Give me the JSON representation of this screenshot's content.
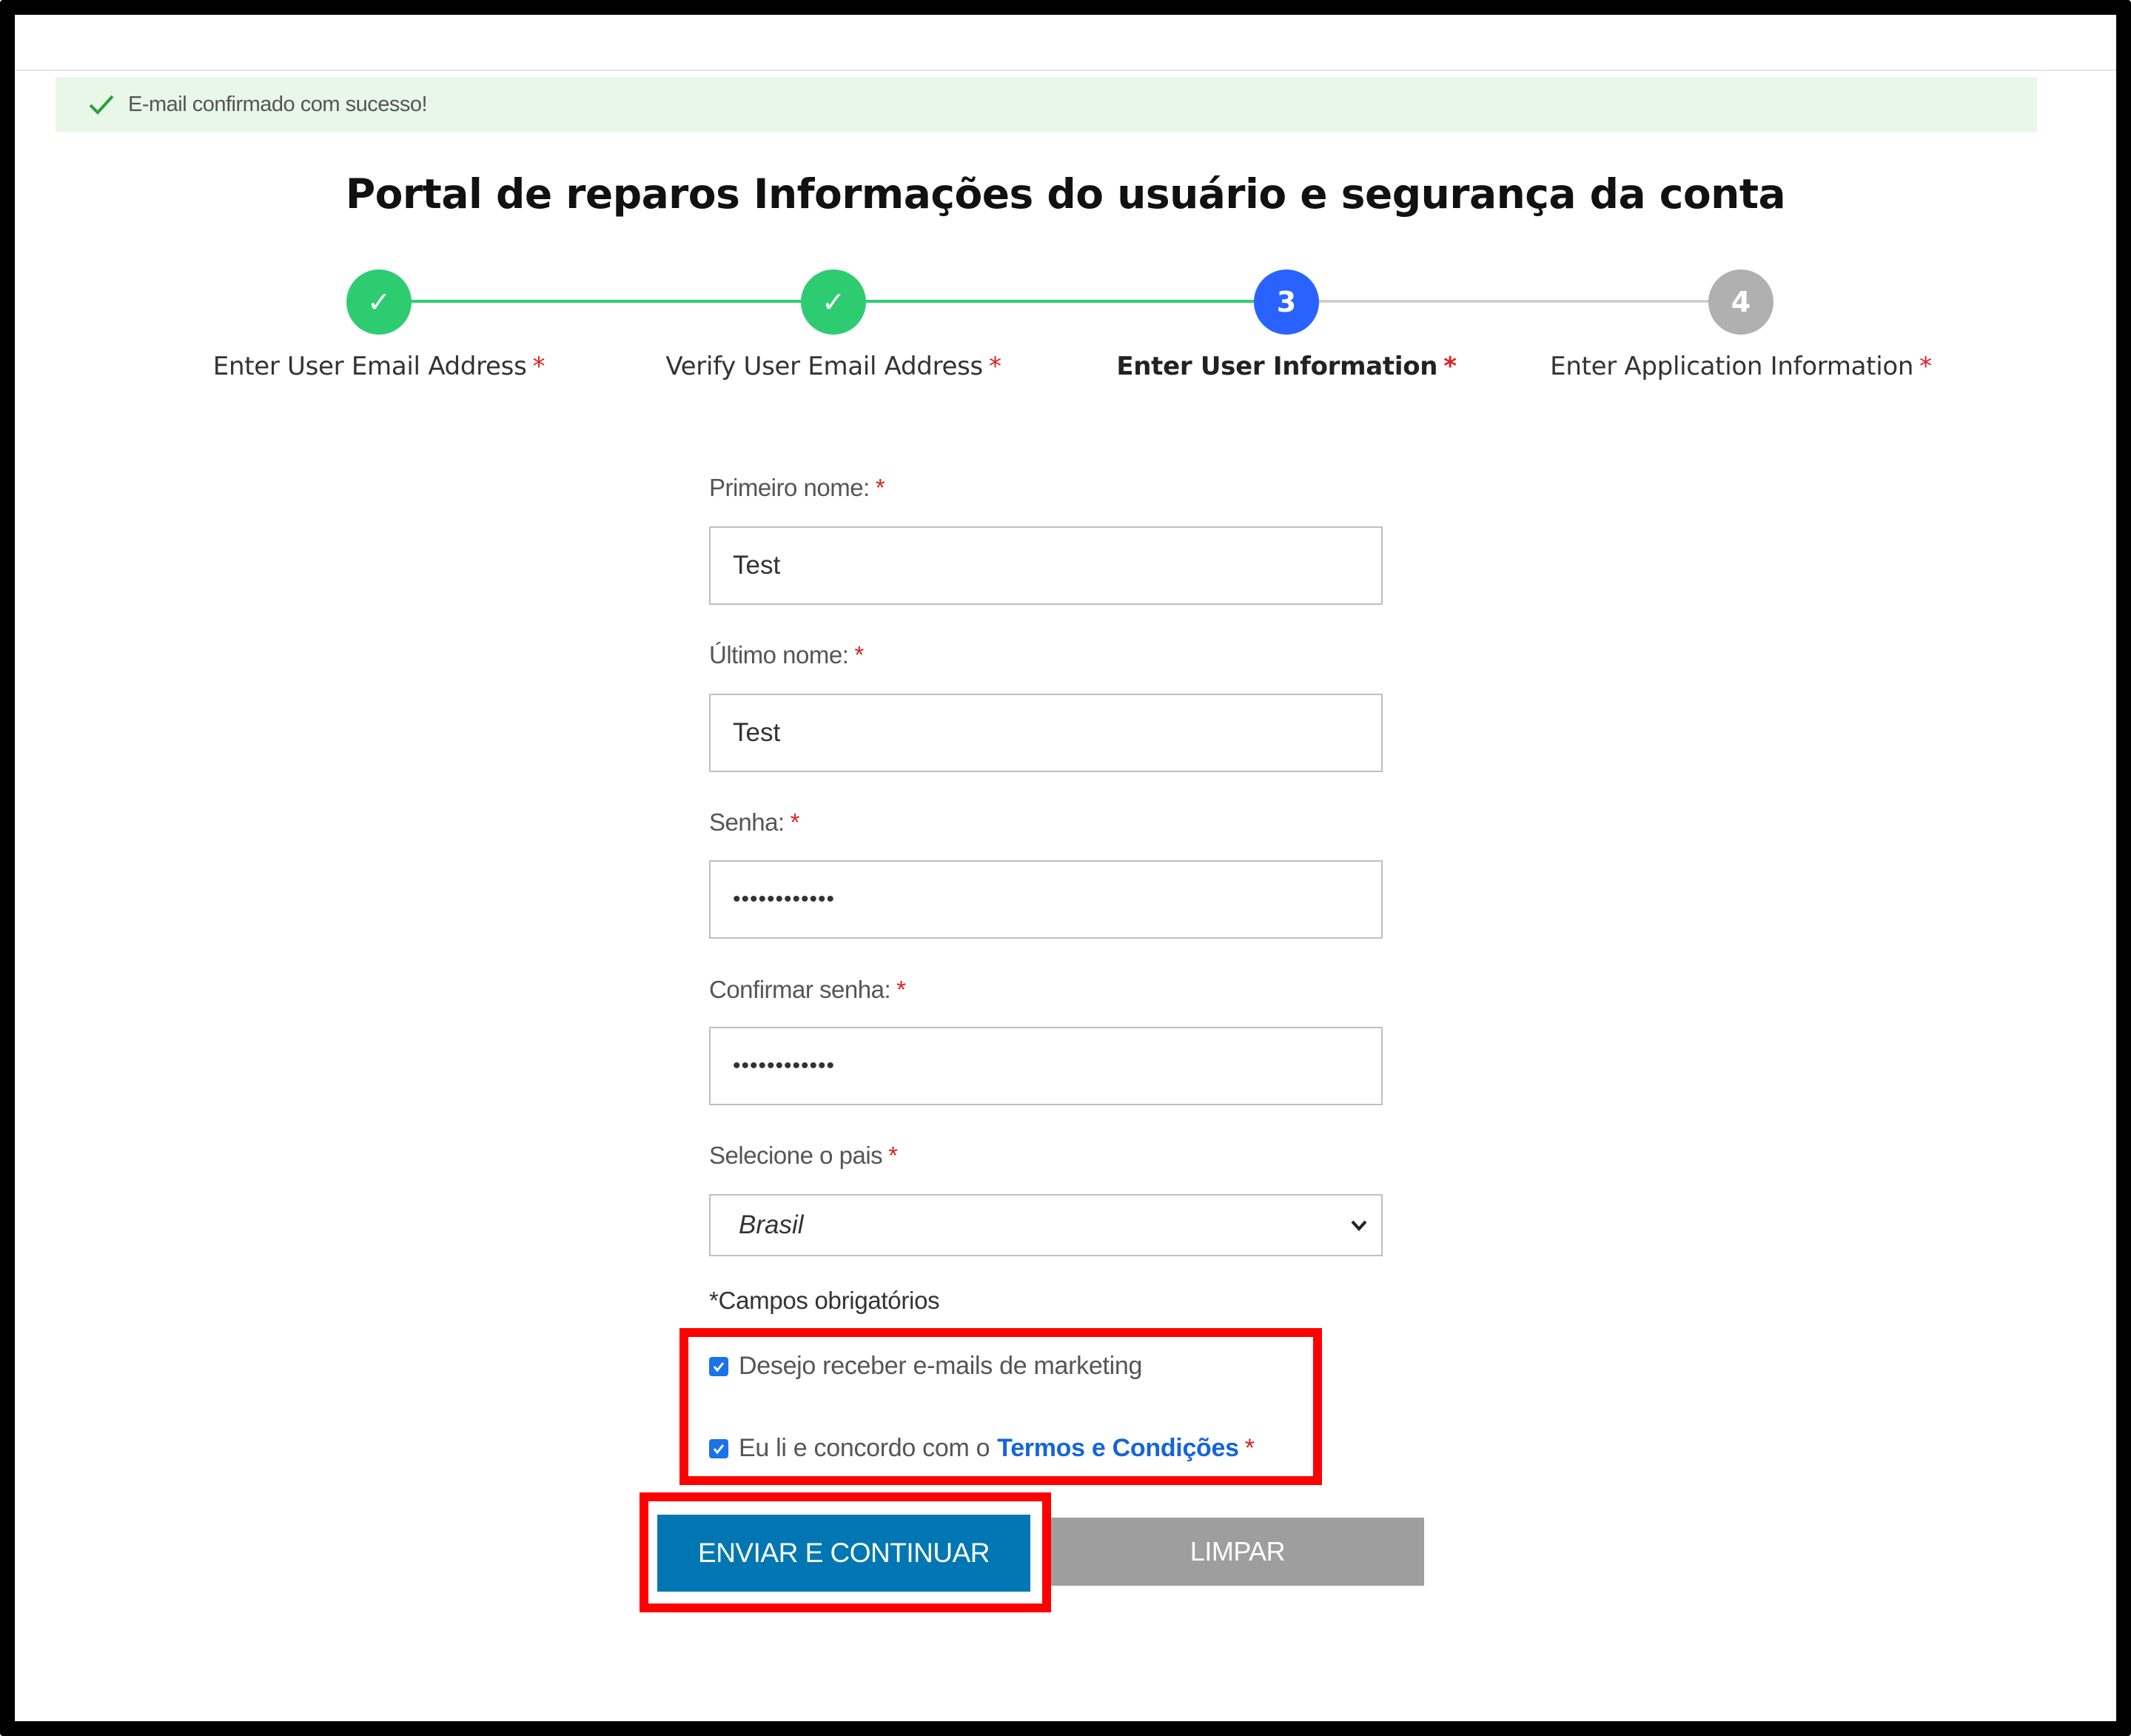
{
  "alert": {
    "icon": "check-icon",
    "message": "E-mail confirmado com sucesso!",
    "color": "#e8f7e8"
  },
  "page": {
    "title": "Portal de reparos Informações do usuário e segurança da conta"
  },
  "stepper": {
    "colors": {
      "done": "#2ecc71",
      "active": "#2962ff",
      "pending": "#b0b0b0"
    },
    "steps": [
      {
        "label": "Enter User Email Address",
        "required": "*",
        "state": "done",
        "marker": "✓"
      },
      {
        "label": "Verify User Email Address",
        "required": "*",
        "state": "done",
        "marker": "✓"
      },
      {
        "label": "Enter User Information",
        "required": "*",
        "state": "active",
        "marker": "3"
      },
      {
        "label": "Enter Application Information",
        "required": "*",
        "state": "pending",
        "marker": "4"
      }
    ]
  },
  "form": {
    "first_name": {
      "label": "Primeiro nome:",
      "required": "*",
      "value": "Test"
    },
    "last_name": {
      "label": "Último nome:",
      "required": "*",
      "value": "Test"
    },
    "password": {
      "label": "Senha:",
      "required": "*",
      "value": "••••••••••••"
    },
    "confirm_password": {
      "label": "Confirmar senha:",
      "required": "*",
      "value": "••••••••••••"
    },
    "country": {
      "label": "Selecione o pais",
      "required": "*",
      "selected": "Brasil"
    },
    "required_note": "*Campos obrigatórios",
    "marketing": {
      "label": "Desejo receber e-mails de marketing",
      "checked": true
    },
    "terms": {
      "prefix": "Eu li e concordo com o",
      "link": "Termos e Condições",
      "required": "*",
      "checked": true
    }
  },
  "buttons": {
    "submit": "ENVIAR E CONTINUAR",
    "clear": "LIMPAR",
    "submit_color": "#0077b3",
    "clear_color": "#9e9e9e"
  },
  "highlight_color": "#ff0000"
}
